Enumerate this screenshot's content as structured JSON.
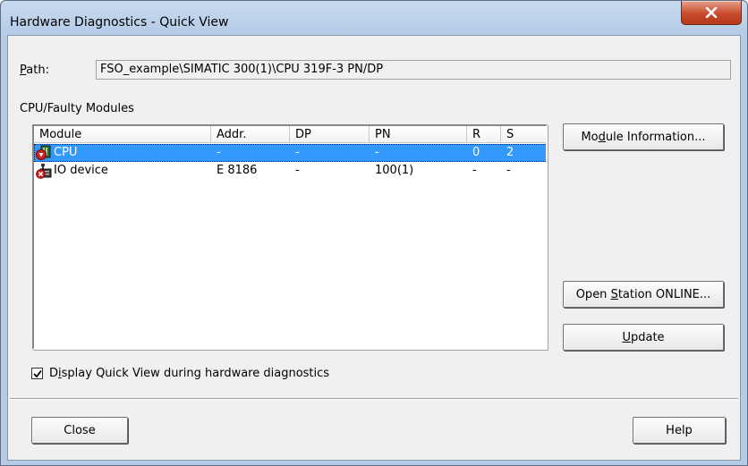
{
  "window": {
    "title": "Hardware Diagnostics - Quick View"
  },
  "path": {
    "label": "Path:",
    "value": "FSO_example\\SIMATIC 300(1)\\CPU 319F-3 PN/DP"
  },
  "list": {
    "group_label": "CPU/Faulty Modules",
    "columns": [
      "Module",
      "Addr.",
      "DP",
      "PN",
      "R",
      "S"
    ],
    "rows": [
      {
        "icon": "cpu-fault-icon",
        "module": "CPU",
        "addr": "-",
        "dp": "-",
        "pn": "-",
        "r": "0",
        "s": "2",
        "selected": true
      },
      {
        "icon": "io-device-fault-icon",
        "module": "IO device",
        "addr": "E 8186",
        "dp": "-",
        "pn": "100(1)",
        "r": "-",
        "s": "-",
        "selected": false
      }
    ]
  },
  "buttons": {
    "module_information": "Module Information...",
    "open_station_online": "Open Station ONLINE...",
    "update": "Update",
    "close": "Close",
    "help": "Help"
  },
  "checkbox": {
    "label": "Display Quick View during hardware diagnostics",
    "checked": true
  },
  "colors": {
    "selection": "#3399ff",
    "titlebar_close": "#c84b2c"
  }
}
